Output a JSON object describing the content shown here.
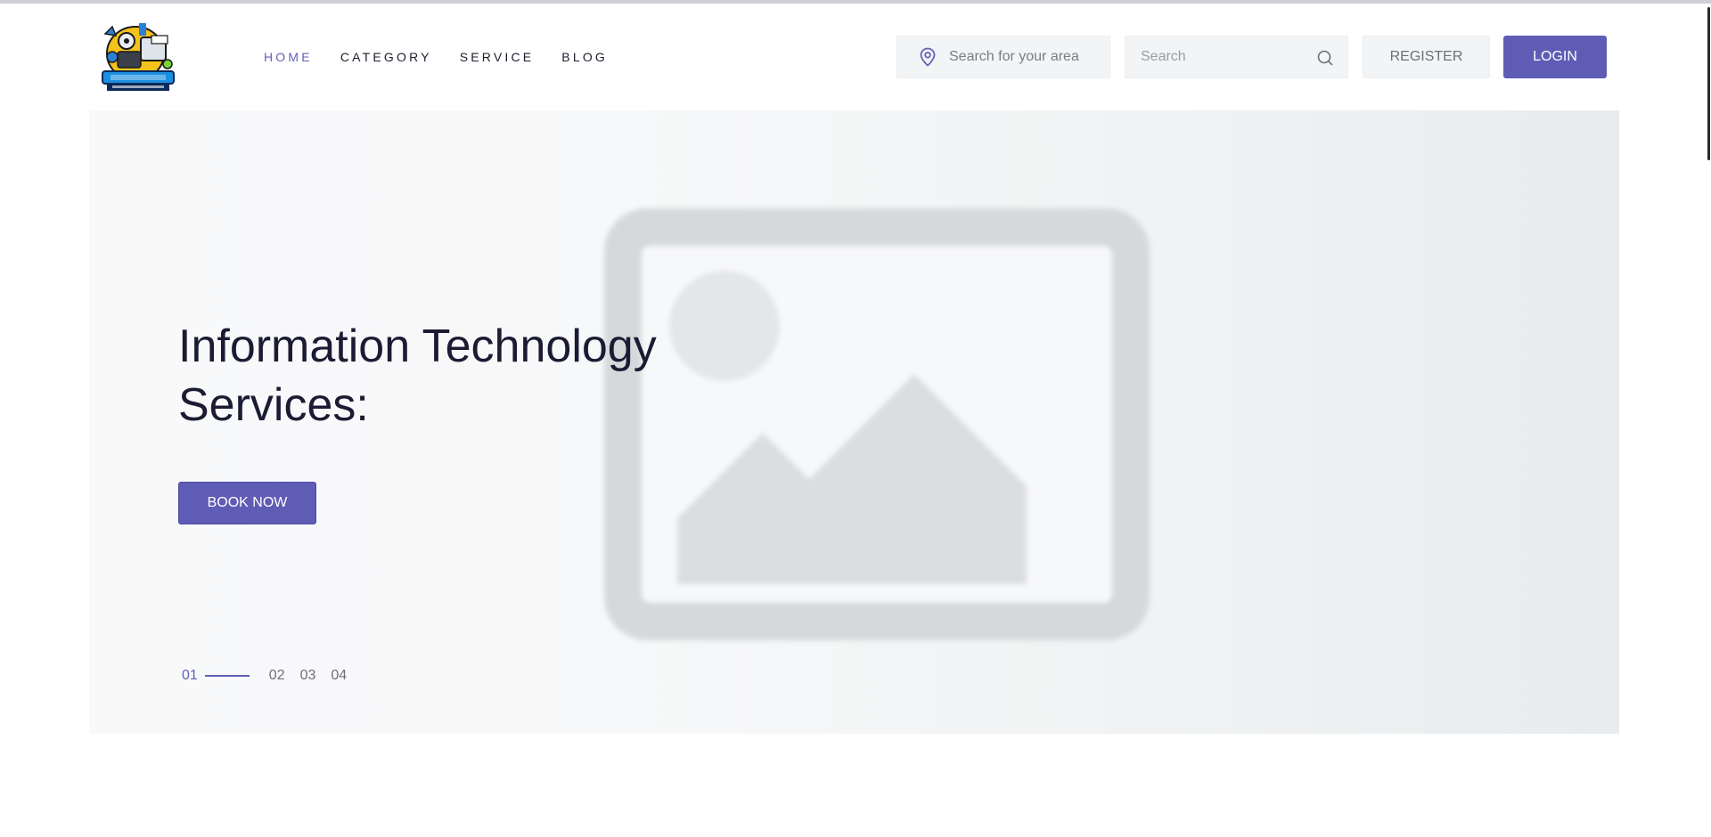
{
  "brand": {
    "logo_alt": "Computer Networking Studies logo"
  },
  "nav": {
    "items": [
      {
        "label": "HOME",
        "active": true
      },
      {
        "label": "CATEGORY",
        "active": false
      },
      {
        "label": "SERVICE",
        "active": false
      },
      {
        "label": "BLOG",
        "active": false
      }
    ]
  },
  "header": {
    "area_search_placeholder": "Search for your area",
    "search_placeholder": "Search",
    "register_label": "REGISTER",
    "login_label": "LOGIN"
  },
  "hero": {
    "title_line1": "Information Technology",
    "title_line2": "Services:",
    "book_label": "BOOK NOW",
    "slides": [
      "01",
      "02",
      "03",
      "04"
    ],
    "active_slide": "01"
  },
  "colors": {
    "accent": "#5f5cb5",
    "text_dark": "#1c1b33",
    "nav_active": "#6461b8"
  },
  "icons": {
    "area": "map-pin-icon",
    "search": "search-icon",
    "image": "image-placeholder-icon"
  }
}
